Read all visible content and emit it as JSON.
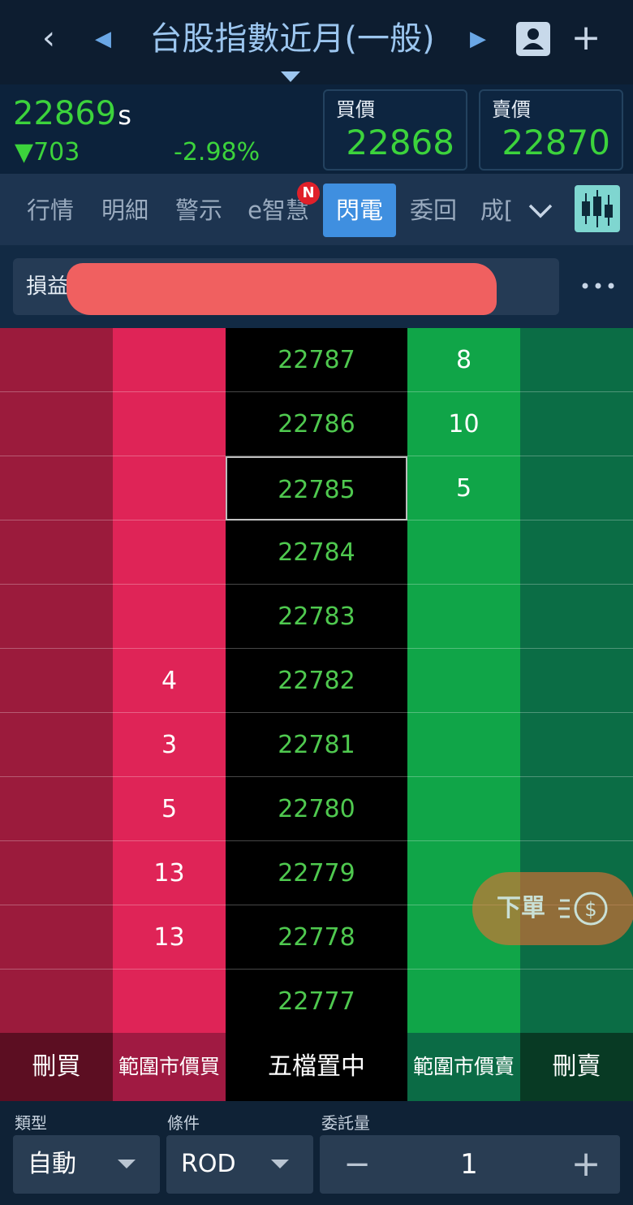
{
  "header": {
    "title": "台股指數近月(一般)",
    "back_icon": "chevron-left-icon",
    "prev_icon": "triangle-left-icon",
    "next_icon": "triangle-right-icon",
    "account_icon": "person-icon",
    "add_label": "+"
  },
  "quote": {
    "last": "22869",
    "last_suffix": "s",
    "change": "▼703",
    "change_pct": "-2.98%",
    "bid_label": "買價",
    "bid": "22868",
    "ask_label": "賣價",
    "ask": "22870",
    "colors": {
      "up_green": "#3cd33c"
    }
  },
  "tabs": {
    "items": [
      {
        "label": "行情"
      },
      {
        "label": "明細"
      },
      {
        "label": "警示"
      },
      {
        "label": "e智慧",
        "badge": "N"
      },
      {
        "label": "閃電",
        "active": true
      },
      {
        "label": "委回"
      },
      {
        "label": "成["
      }
    ],
    "more_icon": "chevron-down-icon",
    "chart_icon": "candlestick-chart-icon"
  },
  "pnl": {
    "label": "損益"
  },
  "ladder": {
    "rows": [
      {
        "price": "22787",
        "bid_qty": "",
        "ask_qty": "8"
      },
      {
        "price": "22786",
        "bid_qty": "",
        "ask_qty": "10"
      },
      {
        "price": "22785",
        "bid_qty": "",
        "ask_qty": "5",
        "selected": true
      },
      {
        "price": "22784",
        "bid_qty": "",
        "ask_qty": ""
      },
      {
        "price": "22783",
        "bid_qty": "",
        "ask_qty": ""
      },
      {
        "price": "22782",
        "bid_qty": "4",
        "ask_qty": ""
      },
      {
        "price": "22781",
        "bid_qty": "3",
        "ask_qty": ""
      },
      {
        "price": "22780",
        "bid_qty": "5",
        "ask_qty": ""
      },
      {
        "price": "22779",
        "bid_qty": "13",
        "ask_qty": ""
      },
      {
        "price": "22778",
        "bid_qty": "13",
        "ask_qty": ""
      },
      {
        "price": "22777",
        "bid_qty": "",
        "ask_qty": ""
      }
    ],
    "colors": {
      "bid_range": "#9b1b3c",
      "bid": "#df2457",
      "ask": "#10a548",
      "ask_range": "#0b6d45",
      "price_text": "#4fc94f"
    }
  },
  "order_button": {
    "label": "下單",
    "icon": "dollar-speed-icon"
  },
  "actions": {
    "delete_buy": "刪買",
    "range_market_buy": "範圍市價買",
    "center": "五檔置中",
    "range_market_sell": "範圍市價賣",
    "delete_sell": "刪賣"
  },
  "form": {
    "type_label": "類型",
    "type_value": "自動",
    "condition_label": "條件",
    "condition_value": "ROD",
    "qty_label": "委託量",
    "qty_value": "1",
    "qty_minus": "−",
    "qty_plus": "+"
  }
}
